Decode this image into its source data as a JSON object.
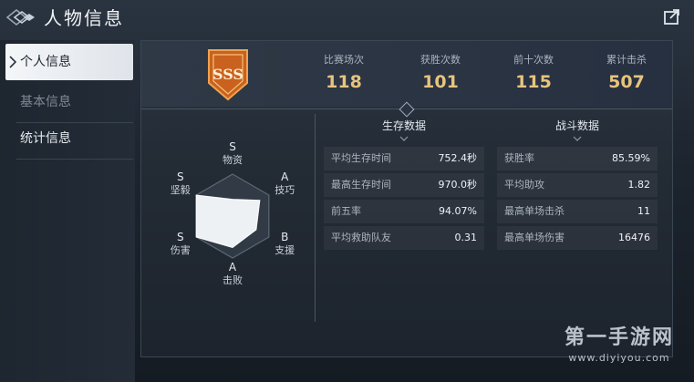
{
  "header": {
    "title": "人物信息",
    "share_icon": "share-icon"
  },
  "sidebar": {
    "items": [
      {
        "label": "个人信息",
        "state": "active"
      },
      {
        "label": "基本信息",
        "state": "dim"
      },
      {
        "label": "统计信息",
        "state": "normal"
      }
    ]
  },
  "rank_badge": {
    "text": "SSS"
  },
  "stats": [
    {
      "label": "比赛场次",
      "value": "118"
    },
    {
      "label": "获胜次数",
      "value": "101"
    },
    {
      "label": "前十次数",
      "value": "115"
    },
    {
      "label": "累计击杀",
      "value": "507"
    }
  ],
  "radar": {
    "axes": [
      {
        "grade": "S",
        "label": "物资",
        "level": 0.4
      },
      {
        "grade": "A",
        "label": "技巧",
        "level": 0.75
      },
      {
        "grade": "B",
        "label": "支援",
        "level": 0.65
      },
      {
        "grade": "A",
        "label": "击败",
        "level": 0.75
      },
      {
        "grade": "S",
        "label": "伤害",
        "level": 1.0
      },
      {
        "grade": "S",
        "label": "坚毅",
        "level": 1.0
      }
    ]
  },
  "survival": {
    "title": "生存数据",
    "rows": [
      {
        "k": "平均生存时间",
        "v": "752.4秒"
      },
      {
        "k": "最高生存时间",
        "v": "970.0秒"
      },
      {
        "k": "前五率",
        "v": "94.07%"
      },
      {
        "k": "平均救助队友",
        "v": "0.31"
      }
    ]
  },
  "combat": {
    "title": "战斗数据",
    "rows": [
      {
        "k": "获胜率",
        "v": "85.59%"
      },
      {
        "k": "平均助攻",
        "v": "1.82"
      },
      {
        "k": "最高单场击杀",
        "v": "11"
      },
      {
        "k": "最高单场伤害",
        "v": "16476"
      }
    ]
  },
  "watermark": {
    "cn": "第一手游网",
    "url": "www.diyiyou.com"
  },
  "colors": {
    "accent_gold": "#e7c47d",
    "badge_orange": "#e0782a"
  }
}
